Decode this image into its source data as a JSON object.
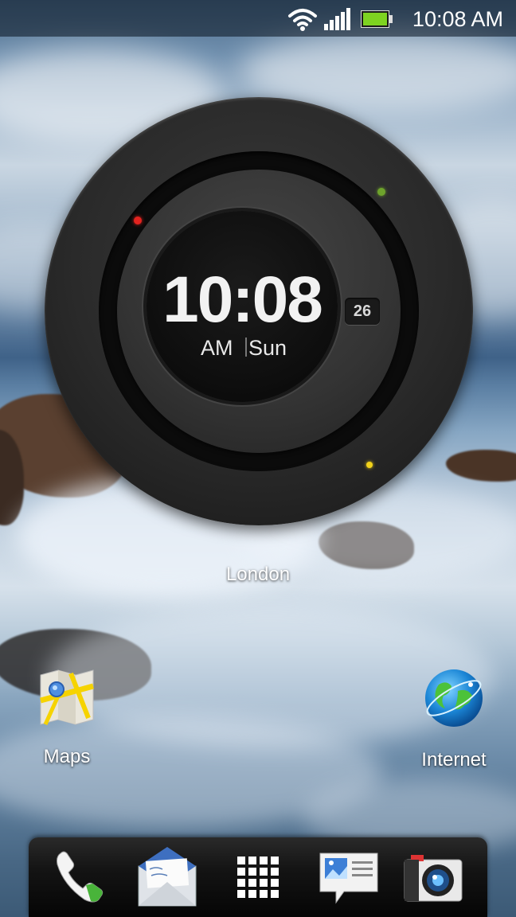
{
  "status_bar": {
    "time": "10:08 AM",
    "icons": [
      "wifi-icon",
      "signal-icon",
      "battery-icon"
    ]
  },
  "clock_widget": {
    "time": "10:08",
    "ampm": "AM",
    "day": "Sun",
    "date": "26",
    "city": "London"
  },
  "apps": [
    {
      "label": "Maps",
      "icon": "maps-icon"
    },
    {
      "label": "Internet",
      "icon": "globe-icon"
    }
  ],
  "dock": {
    "items": [
      "phone-icon",
      "mail-icon",
      "all-apps-icon",
      "messages-icon",
      "camera-icon"
    ]
  },
  "colors": {
    "battery": "#7ed321",
    "dot_red": "#e3231f",
    "dot_green": "#6ea32c",
    "dot_yellow": "#f2d21a"
  }
}
